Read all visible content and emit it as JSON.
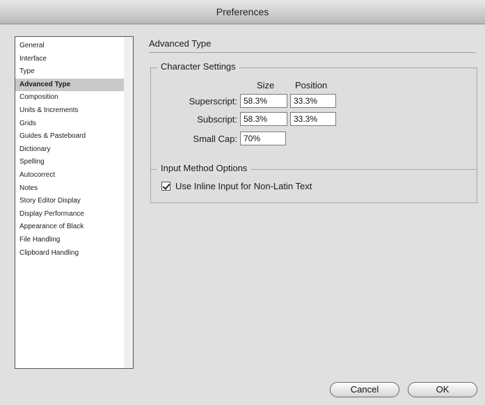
{
  "window": {
    "title": "Preferences"
  },
  "sidebar": {
    "items": [
      {
        "label": "General"
      },
      {
        "label": "Interface"
      },
      {
        "label": "Type"
      },
      {
        "label": "Advanced Type",
        "selected": true
      },
      {
        "label": "Composition"
      },
      {
        "label": "Units & Increments"
      },
      {
        "label": "Grids"
      },
      {
        "label": "Guides & Pasteboard"
      },
      {
        "label": "Dictionary"
      },
      {
        "label": "Spelling"
      },
      {
        "label": "Autocorrect"
      },
      {
        "label": "Notes"
      },
      {
        "label": "Story Editor Display"
      },
      {
        "label": "Display Performance"
      },
      {
        "label": "Appearance of Black"
      },
      {
        "label": "File Handling"
      },
      {
        "label": "Clipboard Handling"
      }
    ]
  },
  "panel": {
    "title": "Advanced Type",
    "character_settings": {
      "title": "Character Settings",
      "col_size": "Size",
      "col_position": "Position",
      "superscript_label": "Superscript:",
      "superscript_size": "58.3%",
      "superscript_position": "33.3%",
      "subscript_label": "Subscript:",
      "subscript_size": "58.3%",
      "subscript_position": "33.3%",
      "smallcap_label": "Small Cap:",
      "smallcap_size": "70%"
    },
    "input_method": {
      "title": "Input Method Options",
      "inline_input_label": "Use Inline Input for Non-Latin Text",
      "inline_input_checked": true
    }
  },
  "buttons": {
    "cancel": "Cancel",
    "ok": "OK"
  }
}
